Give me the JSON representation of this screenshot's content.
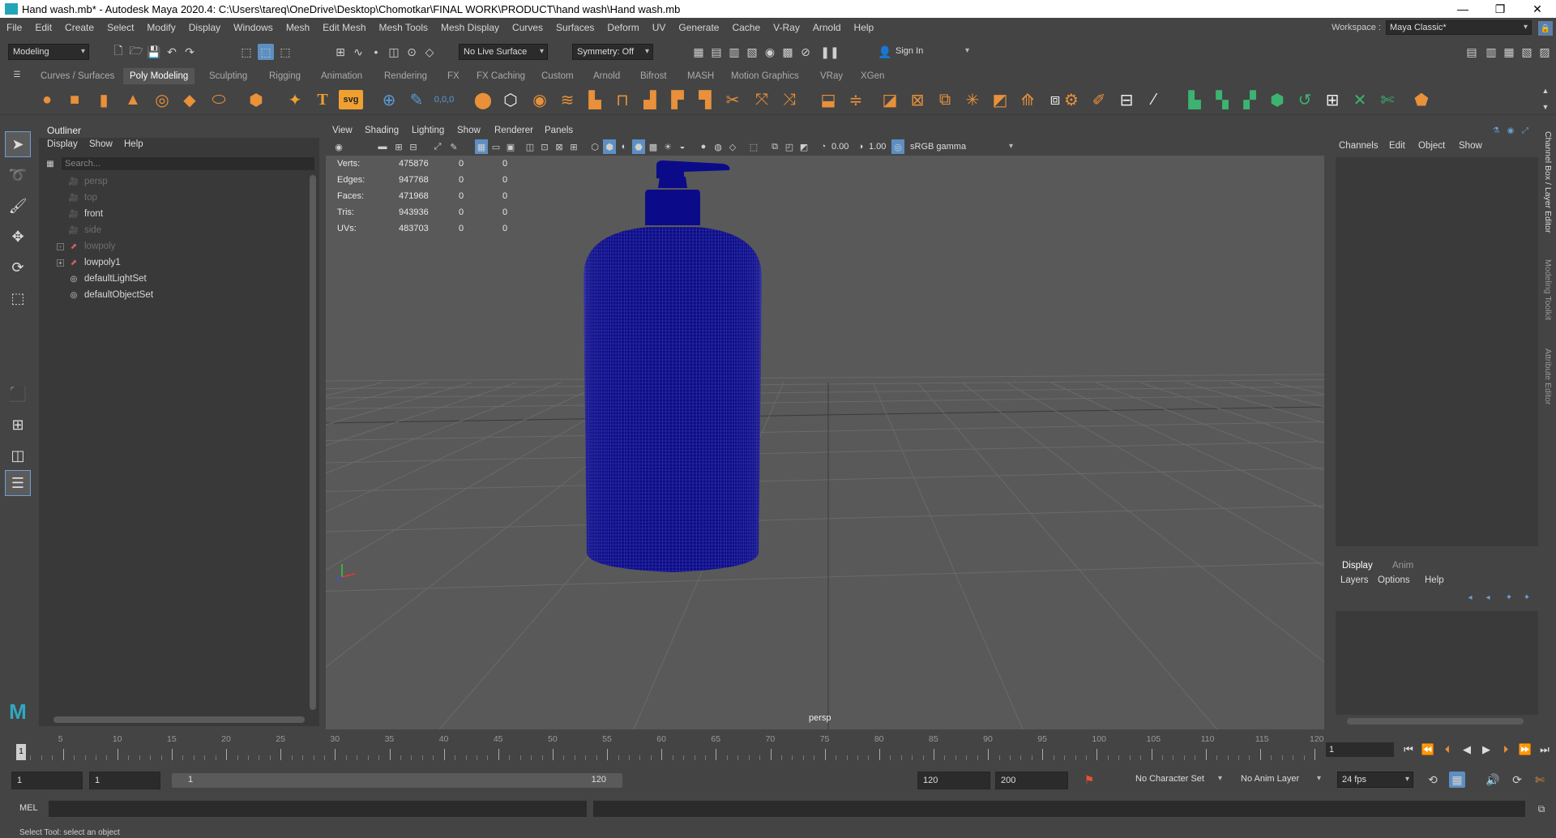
{
  "window": {
    "title": "Hand wash.mb* - Autodesk Maya 2020.4: C:\\Users\\tareq\\OneDrive\\Desktop\\Chomotkar\\FINAL WORK\\PRODUCT\\hand wash\\Hand wash.mb",
    "minimize": "—",
    "restore": "❐",
    "close": "✕"
  },
  "menubar": {
    "items": [
      "File",
      "Edit",
      "Create",
      "Select",
      "Modify",
      "Display",
      "Windows",
      "Mesh",
      "Edit Mesh",
      "Mesh Tools",
      "Mesh Display",
      "Curves",
      "Surfaces",
      "Deform",
      "UV",
      "Generate",
      "Cache",
      "V-Ray",
      "Arnold",
      "Help"
    ],
    "workspace_label": "Workspace :",
    "workspace_value": "Maya Classic*"
  },
  "statusline": {
    "menuset": "Modeling",
    "live_surface": "No Live Surface",
    "symmetry": "Symmetry: Off",
    "sign_in": "Sign In"
  },
  "shelf": {
    "tabs": [
      "Curves / Surfaces",
      "Poly Modeling",
      "Sculpting",
      "Rigging",
      "Animation",
      "Rendering",
      "FX",
      "FX Caching",
      "Custom",
      "Arnold",
      "Bifrost",
      "MASH",
      "Motion Graphics",
      "VRay",
      "XGen"
    ],
    "active_tab": "Poly Modeling",
    "svg_label": "svg",
    "text_label": "T",
    "coords_label": "0,0,0"
  },
  "outliner": {
    "title": "Outliner",
    "menu": [
      "Display",
      "Show",
      "Help"
    ],
    "search_placeholder": "Search...",
    "items": [
      {
        "label": "persp",
        "dim": true
      },
      {
        "label": "top",
        "dim": true
      },
      {
        "label": "front",
        "dim": false
      },
      {
        "label": "side",
        "dim": true
      },
      {
        "label": "lowpoly",
        "dim": true
      },
      {
        "label": "lowpoly1",
        "dim": false
      },
      {
        "label": "defaultLightSet",
        "dim": false
      },
      {
        "label": "defaultObjectSet",
        "dim": false
      }
    ]
  },
  "viewport": {
    "menu": [
      "View",
      "Shading",
      "Lighting",
      "Show",
      "Renderer",
      "Panels"
    ],
    "exposure": "0.00",
    "gamma": "1.00",
    "color_space": "sRGB gamma",
    "camera": "persp",
    "hud": [
      {
        "label": "Verts:",
        "v1": "475876",
        "v2": "0",
        "v3": "0"
      },
      {
        "label": "Edges:",
        "v1": "947768",
        "v2": "0",
        "v3": "0"
      },
      {
        "label": "Faces:",
        "v1": "471968",
        "v2": "0",
        "v3": "0"
      },
      {
        "label": "Tris:",
        "v1": "943936",
        "v2": "0",
        "v3": "0"
      },
      {
        "label": "UVs:",
        "v1": "483703",
        "v2": "0",
        "v3": "0"
      }
    ],
    "wire_color": "#0b0b8a"
  },
  "channelbox": {
    "menu": [
      "Channels",
      "Edit",
      "Object",
      "Show"
    ]
  },
  "layers": {
    "tabs": [
      "Display",
      "Anim"
    ],
    "menu": [
      "Layers",
      "Options",
      "Help"
    ]
  },
  "sidetabs": [
    "Channel Box / Layer Editor",
    "Modeling Toolkit",
    "Attribute Editor"
  ],
  "timeline": {
    "ticks": [
      5,
      10,
      15,
      20,
      25,
      30,
      35,
      40,
      45,
      50,
      55,
      60,
      65,
      70,
      75,
      80,
      85,
      90,
      95,
      100,
      105,
      110,
      115,
      120
    ],
    "current_frame": "1",
    "current_frame_field": "1"
  },
  "range": {
    "start": "1",
    "playback_start": "1",
    "slider_start": "1",
    "slider_end": "120",
    "playback_end": "120",
    "end": "200",
    "character_set": "No Character Set",
    "anim_layer": "No Anim Layer",
    "fps": "24 fps"
  },
  "cmdline": {
    "label": "MEL"
  },
  "helpline": {
    "text": "Select Tool: select an object"
  }
}
